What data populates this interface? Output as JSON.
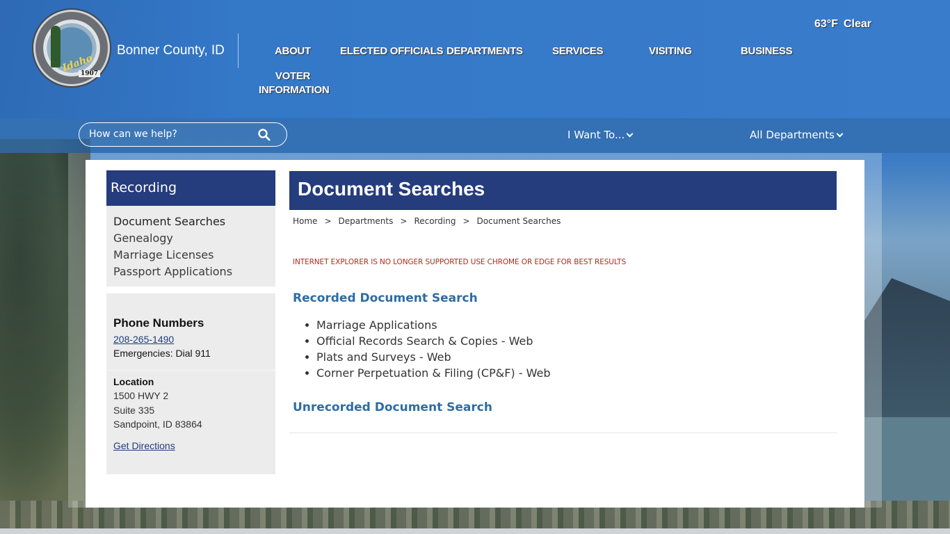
{
  "site": {
    "name": "Bonner County, ID",
    "logo_text": "Idaho",
    "logo_year": "1907"
  },
  "weather": {
    "temp": "63°F",
    "condition": "Clear"
  },
  "nav": {
    "about": "ABOUT",
    "elected_officials": "ELECTED OFFICIALS",
    "departments": "DEPARTMENTS",
    "services": "SERVICES",
    "visiting": "VISITING",
    "business": "BUSINESS",
    "voter_information_line1": "VOTER",
    "voter_information_line2": "INFORMATION"
  },
  "search": {
    "placeholder": "How can we help?"
  },
  "dropdowns": {
    "i_want_to": "I Want To...",
    "all_departments": "All Departments"
  },
  "sidebar": {
    "heading": "Recording",
    "items": [
      {
        "label": "Document Searches"
      },
      {
        "label": "Genealogy"
      },
      {
        "label": "Marriage Licenses"
      },
      {
        "label": "Passport Applications"
      }
    ]
  },
  "contact": {
    "phone_title": "Phone Numbers",
    "phone": "208-265-1490",
    "emergencies": "Emergencies: Dial 911",
    "location_title": "Location",
    "address_line1": "1500 HWY 2",
    "address_line2": "Suite 335",
    "address_line3": "Sandpoint, ID 83864",
    "directions": "Get Directions"
  },
  "main": {
    "title": "Document Searches",
    "breadcrumb": [
      "Home",
      "Departments",
      "Recording",
      "Document Searches"
    ],
    "breadcrumb_sep": ">",
    "ie_warning": "INTERNET EXPLORER IS NO LONGER SUPPORTED USE CHROME OR EDGE FOR BEST RESULTS",
    "recorded_heading": "Recorded Document Search",
    "recorded_items": [
      "Marriage Applications",
      "Official Records Search & Copies - Web",
      "Plats and Surveys - Web",
      "Corner Perpetuation & Filing (CP&F) - Web"
    ],
    "unrecorded_heading": "Unrecorded Document Search"
  },
  "colors": {
    "header_blue": "#3478c8",
    "navy": "#253c7d",
    "link_blue": "#2e6da4",
    "warning_red": "#b02a20"
  }
}
